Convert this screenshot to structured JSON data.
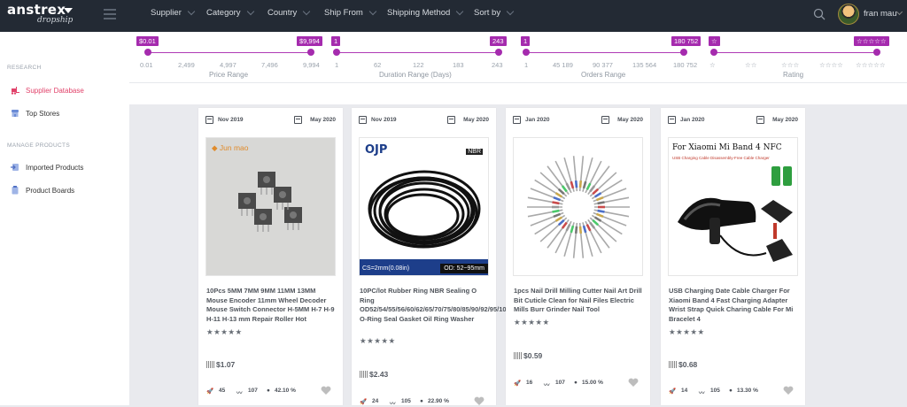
{
  "brand": {
    "name": "anstrex",
    "tagline": "dropship"
  },
  "nav": {
    "supplier": "Supplier",
    "category": "Category",
    "country": "Country",
    "ship_from": "Ship From",
    "shipping_method": "Shipping Method",
    "sort_by": "Sort by"
  },
  "user": {
    "name": "fran mau"
  },
  "sidebar": {
    "research_label": "RESEARCH",
    "manage_label": "MANAGE PRODUCTS",
    "items": [
      {
        "label": "Supplier Database",
        "icon": "forklift-icon",
        "active": true
      },
      {
        "label": "Top Stores",
        "icon": "store-icon",
        "active": false
      },
      {
        "label": "Imported Products",
        "icon": "import-icon",
        "active": false
      },
      {
        "label": "Product Boards",
        "icon": "board-icon",
        "active": false
      }
    ]
  },
  "filters": {
    "price": {
      "title": "Price Range",
      "min_tag": "$0.01",
      "max_tag": "$9,994",
      "ticks": [
        "0.01",
        "2,499",
        "4,997",
        "7,496",
        "9,994"
      ]
    },
    "duration": {
      "title": "Duration Range (Days)",
      "min_tag": "1",
      "max_tag": "243",
      "ticks": [
        "1",
        "62",
        "122",
        "183",
        "243"
      ]
    },
    "orders": {
      "title": "Orders Range",
      "min_tag": "1",
      "max_tag": "180 752",
      "ticks": [
        "1",
        "45 189",
        "90 377",
        "135 564",
        "180 752"
      ]
    },
    "rating": {
      "title": "Rating",
      "min_tag": "☆",
      "max_tag": "☆☆☆☆☆",
      "ticks": [
        "☆",
        "☆☆",
        "☆☆☆",
        "☆☆☆☆",
        "☆☆☆☆☆"
      ]
    }
  },
  "products": [
    {
      "date_from": "Nov 2019",
      "date_to": "May 2020",
      "title": "10Pcs 5MM 7MM 9MM 11MM 13MM Mouse Encoder 11mm Wheel Decoder Mouse Switch Connector H-5MM H-7 H-9 H-11 H-13 mm Repair Roller Hot",
      "image_caption": "Jun mao",
      "stars": "★★★★★",
      "price": "$1.07",
      "orders": "45",
      "trend": "107",
      "rate": "42.10 %"
    },
    {
      "date_from": "Nov 2019",
      "date_to": "May 2020",
      "title": "10PC/lot Rubber Ring NBR Sealing O Ring OD52/54/55/56/60/62/65/70/75/80/85/90/92/95/100*2mm O-Ring Seal Gasket Oil Ring Washer",
      "image_brand": "OJP",
      "image_material": "NBR",
      "image_cs": "CS=2mm(0.08in)",
      "image_od": "OD: 52~95mm",
      "stars": "★★★★★",
      "price": "$2.43",
      "orders": "24",
      "trend": "105",
      "rate": "22.90 %"
    },
    {
      "date_from": "Jan 2020",
      "date_to": "May 2020",
      "title": "1pcs Nail Drill Milling Cutter Nail Art Drill Bit Cuticle Clean for Nail Files Electric Mills Burr Grinder Nail Tool",
      "stars": "★★★★★",
      "price": "$0.59",
      "orders": "16",
      "trend": "107",
      "rate": "15.00 %"
    },
    {
      "date_from": "Jan 2020",
      "date_to": "May 2020",
      "title": "USB Charging Date Cable Charger For Xiaomi Band 4 Fast Charging Adapter Wrist Strap Quick Charing Cable For Mi Bracelet 4",
      "image_heading": "For Xiaomi Mi Band 4 NFC",
      "image_subheading": "USB Charging Cable Disassembly-Free Cable Charger",
      "stars": "★★★★★",
      "price": "$0.68",
      "orders": "14",
      "trend": "105",
      "rate": "13.30 %"
    }
  ],
  "colors": {
    "accent": "#a52bae",
    "active": "#e1426a",
    "topbar": "#232a34"
  }
}
